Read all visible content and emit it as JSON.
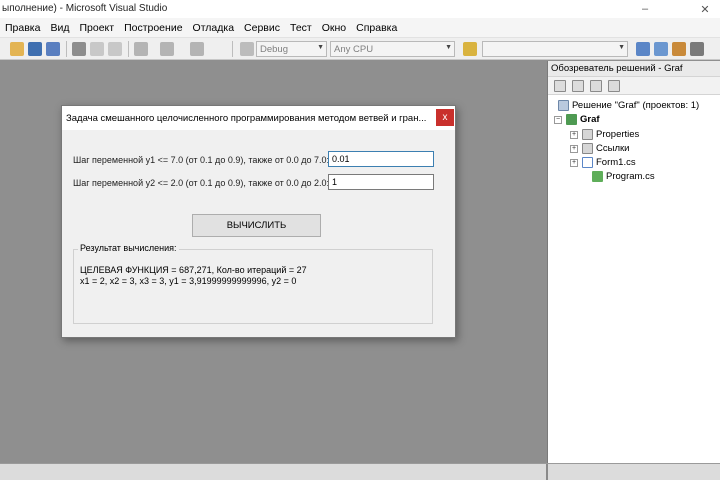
{
  "window": {
    "title": "ыполнение) - Microsoft Visual Studio"
  },
  "menu": [
    "Правка",
    "Вид",
    "Проект",
    "Построение",
    "Отладка",
    "Сервис",
    "Тест",
    "Окно",
    "Справка"
  ],
  "toolbar": {
    "config": "Debug",
    "platform": "Any CPU"
  },
  "solution_explorer": {
    "title": "Обозреватель решений - Graf",
    "solution": "Решение \"Graf\"  (проектов: 1)",
    "project": "Graf",
    "items": [
      "Properties",
      "Ссылки",
      "Form1.cs",
      "Program.cs"
    ]
  },
  "dialog": {
    "title": "Задача смешанного целочисленного программирования методом ветвей и гран...",
    "close": "x",
    "y1_label": "Шаг переменной y1 <= 7.0 (от 0.1 до 0.9), также от 0.0 до 7.0:",
    "y1_value": "0.01",
    "y2_label": "Шаг переменной y2 <= 2.0 (от 0.1 до 0.9), также от 0.0 до 2.0:",
    "y2_value": "1",
    "compute_button": "ВЫЧИСЛИТЬ",
    "result_label": "Результат вычисления:",
    "result_line1": "ЦЕЛЕВАЯ ФУНКЦИЯ = 687,271, Кол-во итераций = 27",
    "result_line2": "x1 = 2, x2 = 3, x3 = 3, y1 = 3,91999999999996, y2 = 0"
  }
}
